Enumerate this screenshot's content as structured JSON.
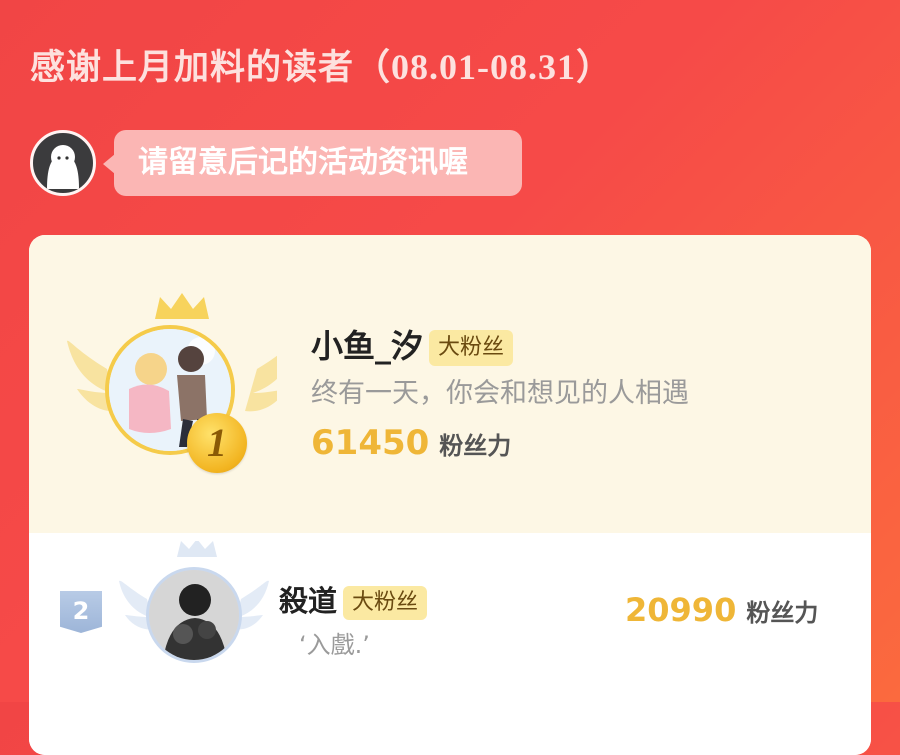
{
  "header": {
    "title": "感谢上月加料的读者",
    "range": "（08.01-08.31）"
  },
  "notice": {
    "text": "请留意后记的活动资讯喔",
    "mascot_icon": "ghost-mascot-icon"
  },
  "ranking": [
    {
      "rank": "1",
      "name": "小鱼_汐",
      "badge": "大粉丝",
      "motto": "终有一天，你会和想见的人相遇",
      "score": "61450",
      "unit": "粉丝力"
    },
    {
      "rank": "2",
      "name": "殺道",
      "badge": "大粉丝",
      "motto": "‘入戲.’",
      "score": "20990",
      "unit": "粉丝力"
    }
  ],
  "colors": {
    "background": "#f24646",
    "accent_gold": "#efb637",
    "badge_bg": "#fbe9a2"
  }
}
